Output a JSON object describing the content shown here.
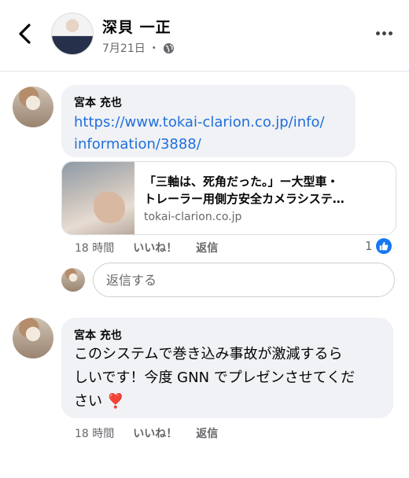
{
  "header": {
    "author_name": "深貝 一正",
    "post_date": "7月21日",
    "meta_separator": "・"
  },
  "comments": [
    {
      "author": "宮本 充也",
      "link_line1": "https://www.tokai-clarion.co.jp/info/",
      "link_line2": "information/3888/",
      "preview": {
        "title_line1": "「三軸は、死角だった。」ー大型車・",
        "title_line2": "トレーラー用側方安全カメラシステ…",
        "domain": "tokai-clarion.co.jp"
      },
      "time": "18 時間",
      "like_label": "いいね！",
      "reply_label": "返信",
      "reaction_count": "1"
    },
    {
      "author": "宮本 充也",
      "text_line1": "このシステムで巻き込み事故が激減するら",
      "text_line2": "しいです！今度 GNN でプレゼンさせてくだ",
      "text_line3": "さい",
      "emoji": "❣️",
      "time": "18 時間",
      "like_label": "いいね！",
      "reply_label": "返信"
    }
  ],
  "reply_box": {
    "placeholder": "返信する"
  },
  "icons": {
    "back": "chevron-left-icon",
    "more": "more-dots-icon",
    "globe": "globe-icon",
    "like": "thumbs-up-icon"
  },
  "colors": {
    "link": "#216fdb",
    "like_badge": "#1877f2",
    "bubble": "#f0f2f5"
  }
}
